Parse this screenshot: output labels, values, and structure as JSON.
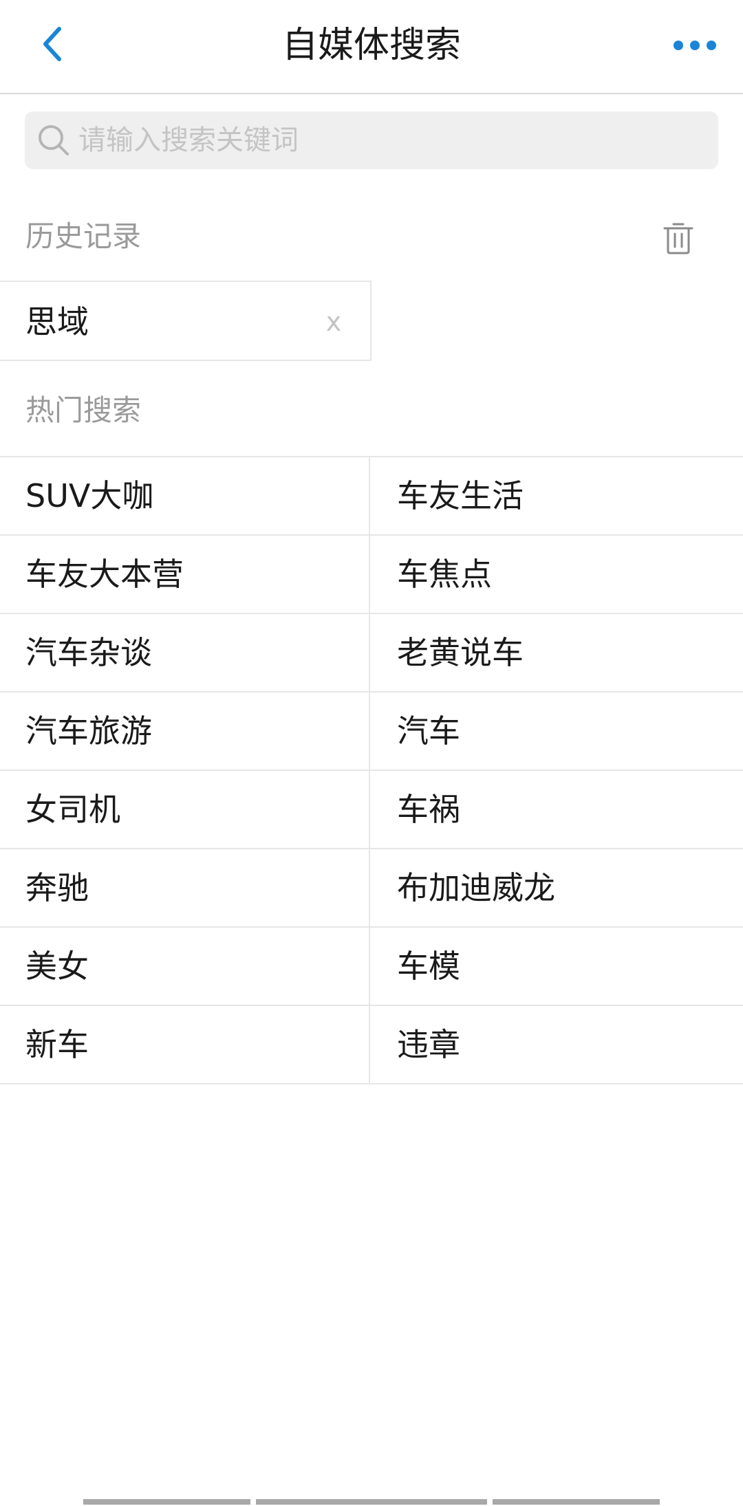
{
  "header": {
    "title": "自媒体搜索",
    "back_icon": "chevron-left-icon",
    "more_icon": "more-horizontal-icon",
    "accent_color": "#1a85d6"
  },
  "search": {
    "placeholder": "请输入搜索关键词",
    "value": "",
    "icon": "search-icon"
  },
  "history": {
    "title": "历史记录",
    "clear_icon": "trash-icon",
    "items": [
      {
        "label": "思域",
        "remove_label": "x"
      }
    ]
  },
  "hot": {
    "title": "热门搜索",
    "items": [
      {
        "label": "SUV大咖"
      },
      {
        "label": "车友生活"
      },
      {
        "label": "车友大本营"
      },
      {
        "label": "车焦点"
      },
      {
        "label": "汽车杂谈"
      },
      {
        "label": "老黄说车"
      },
      {
        "label": "汽车旅游"
      },
      {
        "label": "汽车"
      },
      {
        "label": "女司机"
      },
      {
        "label": "车祸"
      },
      {
        "label": "奔驰"
      },
      {
        "label": "布加迪威龙"
      },
      {
        "label": "美女"
      },
      {
        "label": "车模"
      },
      {
        "label": "新车"
      },
      {
        "label": "违章"
      }
    ]
  }
}
